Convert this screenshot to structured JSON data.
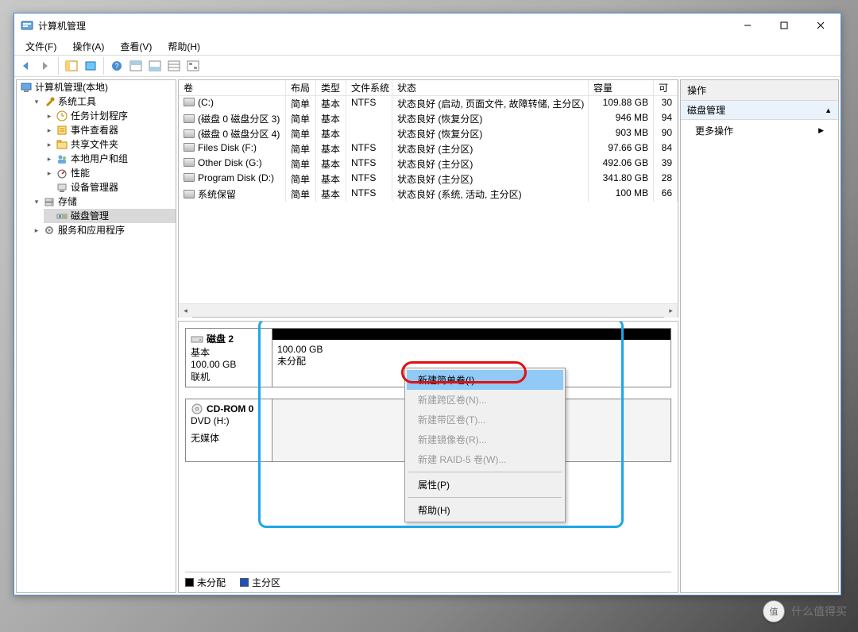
{
  "window": {
    "title": "计算机管理"
  },
  "menu": {
    "file": "文件(F)",
    "action": "操作(A)",
    "view": "查看(V)",
    "help": "帮助(H)"
  },
  "tree": {
    "root": "计算机管理(本地)",
    "sys_tools": "系统工具",
    "task_scheduler": "任务计划程序",
    "event_viewer": "事件查看器",
    "shared_folders": "共享文件夹",
    "local_users": "本地用户和组",
    "performance": "性能",
    "device_manager": "设备管理器",
    "storage": "存储",
    "disk_management": "磁盘管理",
    "services": "服务和应用程序"
  },
  "vol_header": {
    "vol": "卷",
    "layout": "布局",
    "type": "类型",
    "fs": "文件系统",
    "status": "状态",
    "capacity": "容量",
    "free": "可"
  },
  "volumes": [
    {
      "name": "(C:)",
      "layout": "简单",
      "type": "基本",
      "fs": "NTFS",
      "status": "状态良好 (启动, 页面文件, 故障转储, 主分区)",
      "capacity": "109.88 GB",
      "free": "30"
    },
    {
      "name": "(磁盘 0 磁盘分区 3)",
      "layout": "简单",
      "type": "基本",
      "fs": "",
      "status": "状态良好 (恢复分区)",
      "capacity": "946 MB",
      "free": "94"
    },
    {
      "name": "(磁盘 0 磁盘分区 4)",
      "layout": "简单",
      "type": "基本",
      "fs": "",
      "status": "状态良好 (恢复分区)",
      "capacity": "903 MB",
      "free": "90"
    },
    {
      "name": "Files Disk (F:)",
      "layout": "简单",
      "type": "基本",
      "fs": "NTFS",
      "status": "状态良好 (主分区)",
      "capacity": "97.66 GB",
      "free": "84"
    },
    {
      "name": "Other Disk (G:)",
      "layout": "简单",
      "type": "基本",
      "fs": "NTFS",
      "status": "状态良好 (主分区)",
      "capacity": "492.06 GB",
      "free": "39"
    },
    {
      "name": "Program Disk (D:)",
      "layout": "简单",
      "type": "基本",
      "fs": "NTFS",
      "status": "状态良好 (主分区)",
      "capacity": "341.80 GB",
      "free": "28"
    },
    {
      "name": "系统保留",
      "layout": "简单",
      "type": "基本",
      "fs": "NTFS",
      "status": "状态良好 (系统, 活动, 主分区)",
      "capacity": "100 MB",
      "free": "66"
    }
  ],
  "disk2": {
    "title": "磁盘 2",
    "type": "基本",
    "size": "100.00 GB",
    "status": "联机",
    "part_size": "100.00 GB",
    "part_state": "未分配"
  },
  "cdrom": {
    "title": "CD-ROM 0",
    "type": "DVD (H:)",
    "status": "无媒体"
  },
  "legend": {
    "unalloc": "未分配",
    "primary": "主分区"
  },
  "ctx": {
    "new_simple": "新建简单卷(I)...",
    "new_spanned": "新建跨区卷(N)...",
    "new_striped": "新建带区卷(T)...",
    "new_mirror": "新建镜像卷(R)...",
    "new_raid5": "新建 RAID-5 卷(W)...",
    "properties": "属性(P)",
    "help": "帮助(H)"
  },
  "actions": {
    "header": "操作",
    "section": "磁盘管理",
    "more": "更多操作"
  },
  "watermark": "什么值得买"
}
